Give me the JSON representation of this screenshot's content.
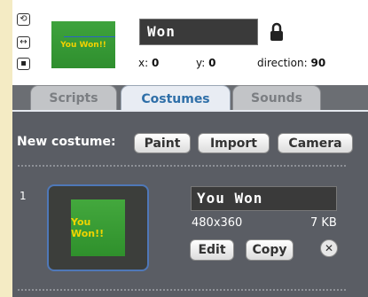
{
  "sprite": {
    "name": "Won",
    "thumbnail_text": "You Won!!",
    "x_label": "x:",
    "x_value": "0",
    "y_label": "y:",
    "y_value": "0",
    "direction_label": "direction:",
    "direction_value": "90",
    "rotation_icons": [
      "rotate-icon",
      "flip-icon",
      "no-rotate-icon"
    ],
    "lock_icon": "lock-icon"
  },
  "tabs": [
    {
      "label": "Scripts",
      "active": false
    },
    {
      "label": "Costumes",
      "active": true
    },
    {
      "label": "Sounds",
      "active": false
    }
  ],
  "new_costume": {
    "label": "New costume:",
    "buttons": [
      "Paint",
      "Import",
      "Camera"
    ]
  },
  "costumes": [
    {
      "number": "1",
      "name": "You Won",
      "image_text": "You Won!!",
      "dimensions": "480x360",
      "size": "7 KB",
      "edit_label": "Edit",
      "copy_label": "Copy",
      "delete_icon": "delete-icon"
    }
  ],
  "colors": {
    "panel": "#5a5d64",
    "active_tab_text": "#2f6fa8",
    "costume_green": "#3ea33d",
    "costume_text": "#f3d200",
    "selection_border": "#4f78b8"
  }
}
